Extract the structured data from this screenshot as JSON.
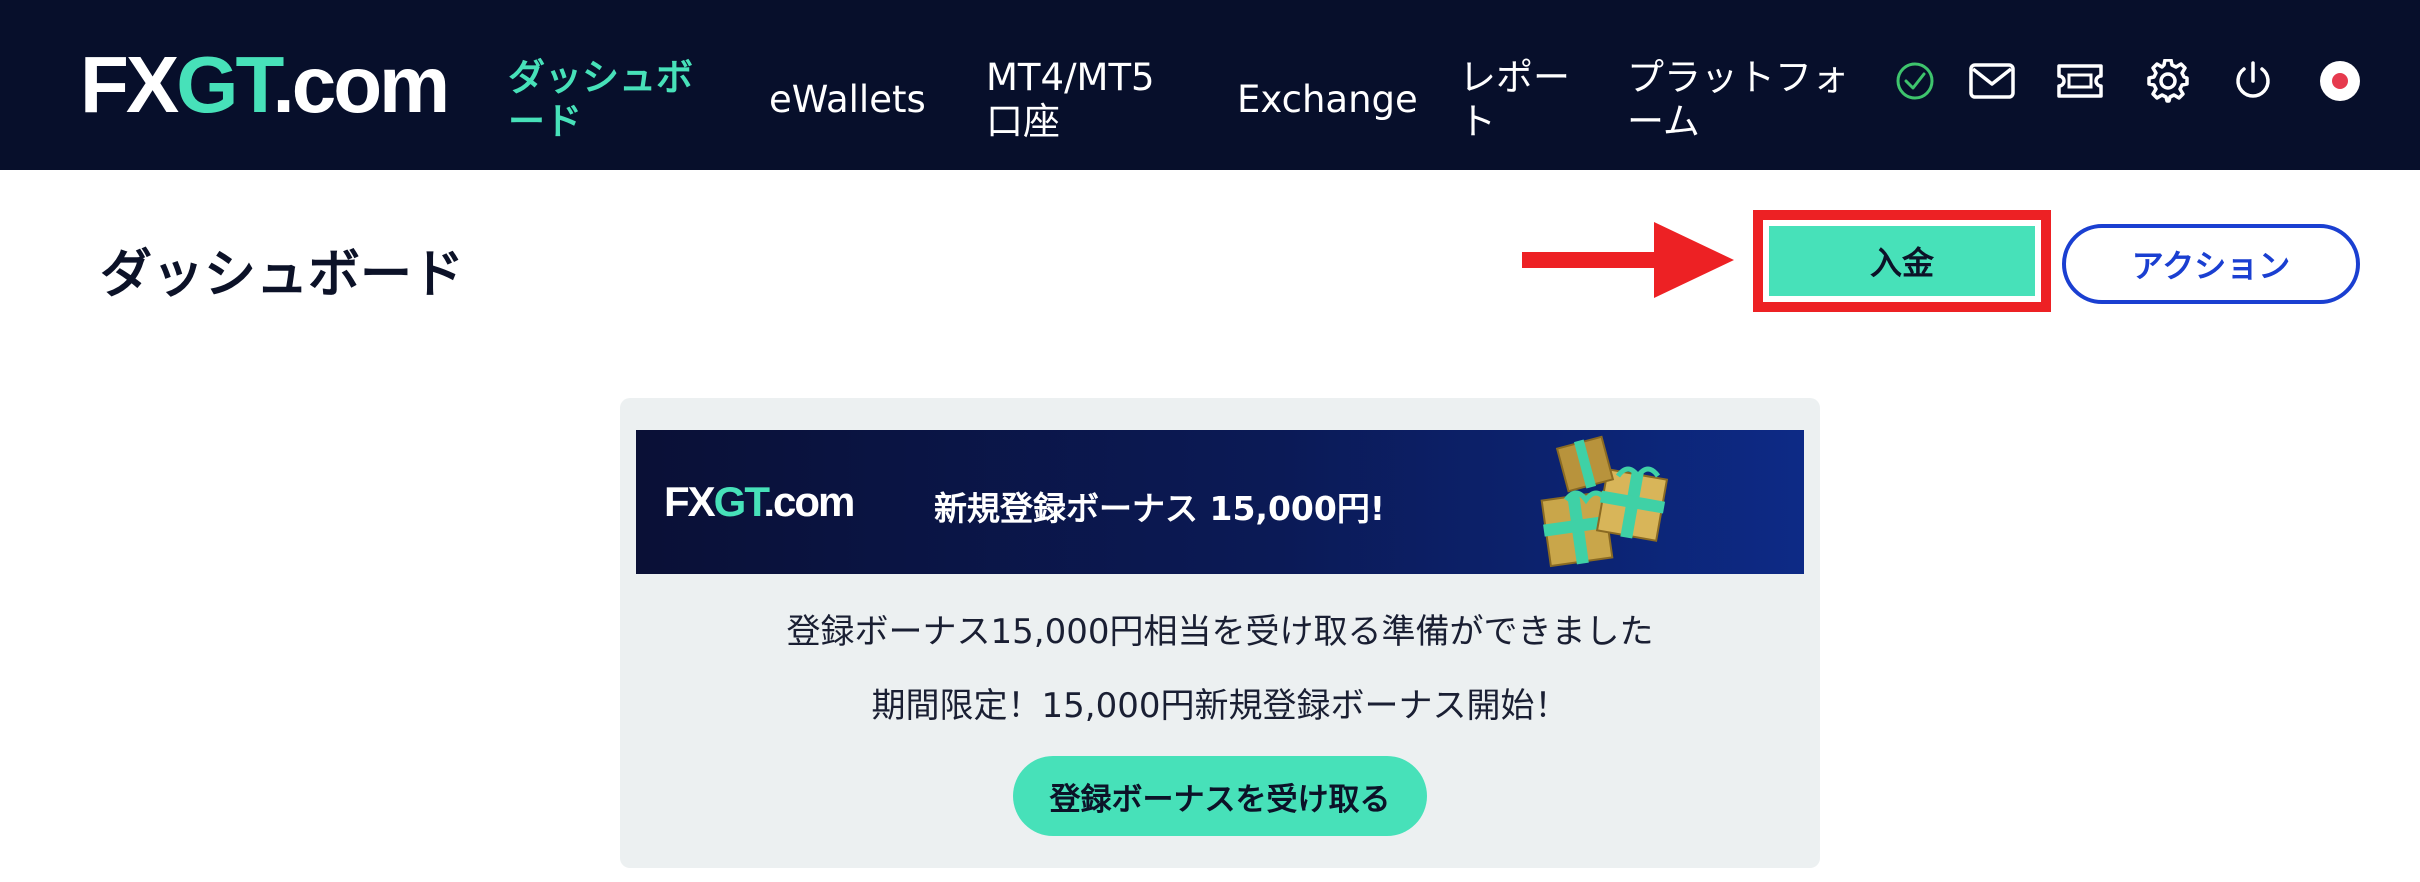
{
  "header": {
    "logo": {
      "part1": "FX",
      "part2": "GT",
      "part3": ".com"
    },
    "nav": [
      {
        "line1": "ダッシュボ",
        "line2": "ード"
      },
      {
        "line1": "eWallets",
        "line2": ""
      },
      {
        "line1": "MT4/MT5",
        "line2": "口座"
      },
      {
        "line1": "Exchange",
        "line2": ""
      },
      {
        "line1": "レポー",
        "line2": "ト"
      },
      {
        "line1": "プラットフォ",
        "line2": "ーム"
      }
    ],
    "icons": [
      "verified-check-icon",
      "mail-icon",
      "ticket-icon",
      "gear-icon",
      "power-icon",
      "japan-flag-icon"
    ]
  },
  "page": {
    "title": "ダッシュボード",
    "deposit_label": "入金",
    "action_label": "アクション"
  },
  "promo": {
    "banner_logo": {
      "part1": "FX",
      "part2": "GT",
      "part3": ".com"
    },
    "banner_text": "新規登録ボーナス 15,000円!",
    "line1": "登録ボーナス15,000円相当を受け取る準備ができました",
    "line2": "期間限定！15,000円新規登録ボーナス開始！",
    "claim_label": "登録ボーナスを受け取る"
  },
  "colors": {
    "nav_bg": "#070f2b",
    "accent": "#47e1b9",
    "action_blue": "#1a3fd1",
    "highlight_red": "#ed2124",
    "card_bg": "#ecf0f1"
  }
}
